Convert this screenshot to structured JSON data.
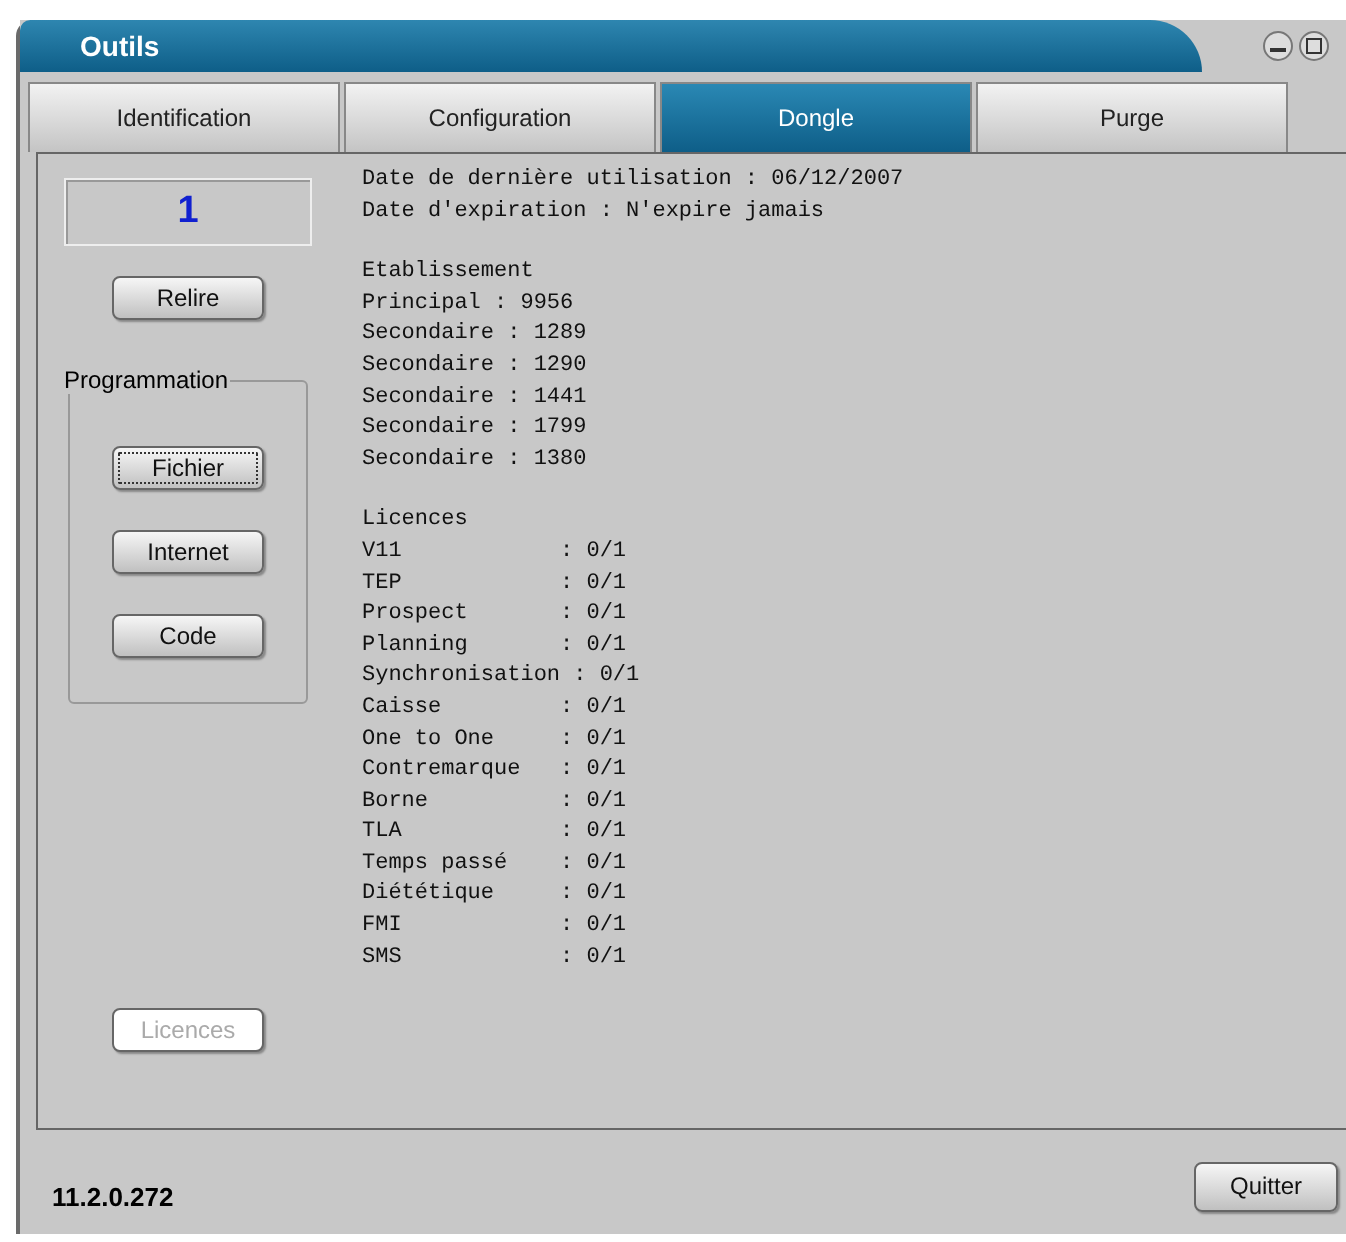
{
  "window": {
    "title": "Outils"
  },
  "tabs": [
    {
      "label": "Identification",
      "selected": false
    },
    {
      "label": "Configuration",
      "selected": false
    },
    {
      "label": "Dongle",
      "selected": true
    },
    {
      "label": "Purge",
      "selected": false
    }
  ],
  "counter": "1",
  "reread_button": {
    "label": "Relire",
    "disabled": false
  },
  "programmation": {
    "title": "Programmation",
    "buttons": [
      {
        "label": "Fichier",
        "focused": true
      },
      {
        "label": "Internet",
        "focused": false
      },
      {
        "label": "Code",
        "focused": false
      }
    ]
  },
  "licences_button": {
    "label": "Licences",
    "disabled": true
  },
  "info_lines": [
    "Date de dernière utilisation : 06/12/2007",
    "Date d'expiration : N'expire jamais"
  ],
  "establishment_lines": [
    "Etablissement",
    "Principal : 9956",
    "Secondaire : 1289",
    "Secondaire : 1290",
    "Secondaire : 1441",
    "Secondaire : 1799",
    "Secondaire : 1380"
  ],
  "licence_lines": [
    "Licences",
    "V11            : 0/1",
    "TEP            : 0/1",
    "Prospect       : 0/1",
    "Planning       : 0/1",
    "Synchronisation : 0/1",
    "Caisse         : 0/1",
    "One to One     : 0/1",
    "Contremarque   : 0/1",
    "Borne          : 0/1",
    "TLA            : 0/1",
    "Temps passé    : 0/1",
    "Diététique     : 0/1",
    "FMI            : 0/1",
    "SMS            : 0/1"
  ],
  "status_bar": {
    "version": "11.2.0.272",
    "quit_button": "Quitter"
  }
}
